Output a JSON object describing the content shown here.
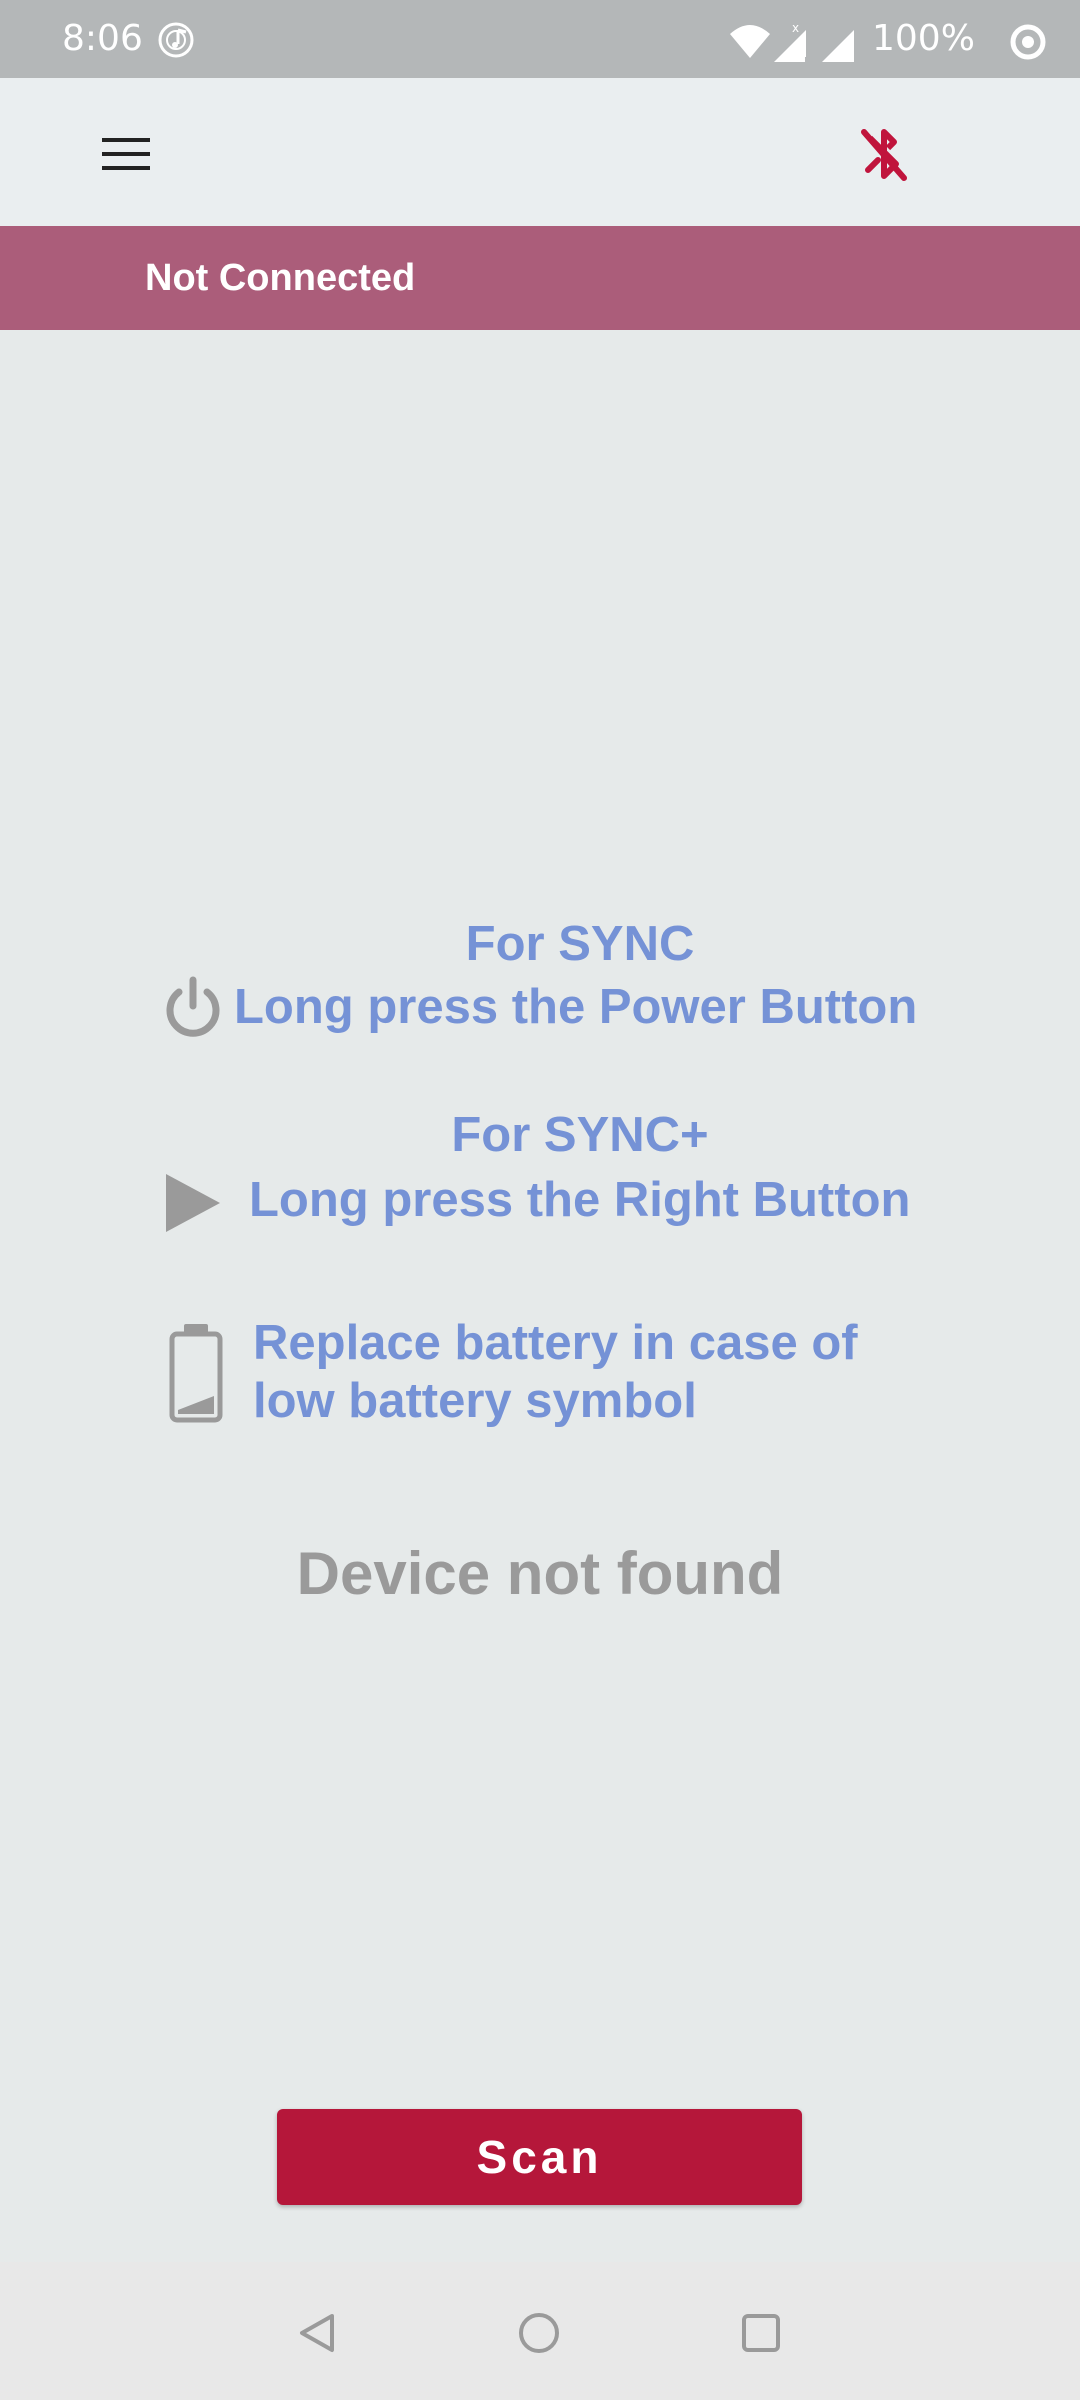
{
  "status_bar": {
    "time": "8:06",
    "battery_percent": "100%",
    "icons": [
      "music-app-icon",
      "wifi-icon",
      "signal-roaming-icon",
      "signal-icon",
      "battery-ring-icon"
    ]
  },
  "toolbar": {
    "menu_icon": "hamburger-menu-icon",
    "bluetooth_icon": "bluetooth-disabled-icon",
    "bluetooth_icon_color": "#c0143c"
  },
  "connection": {
    "status_text": "Not Connected",
    "banner_color": "#ab5d7a"
  },
  "instructions": {
    "sync_title": "For SYNC",
    "sync_text": "Long press the Power Button",
    "sync_plus_title": "For SYNC+",
    "sync_plus_text": "Long press the Right Button",
    "battery_line1": "Replace battery in case of",
    "battery_line2": "low battery symbol",
    "text_color": "#7592d6"
  },
  "device_status": "Device not found",
  "scan_button": {
    "label": "Scan",
    "color": "#b5173a"
  },
  "nav_bar": {
    "icons": [
      "back-icon",
      "home-icon",
      "recents-icon"
    ]
  }
}
